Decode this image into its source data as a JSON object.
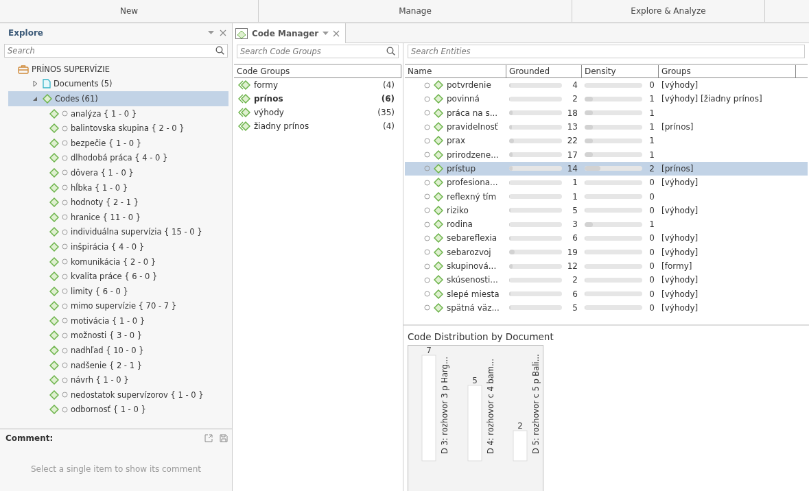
{
  "ribbon_tabs": [
    {
      "label": "New"
    },
    {
      "label": "Manage"
    },
    {
      "label": "Explore & Analyze"
    }
  ],
  "explore": {
    "title": "Explore",
    "search": {
      "placeholder": "Search"
    },
    "tree": [
      {
        "label": "PRÍNOS SUPERVÍZIE",
        "kind": "project",
        "selected": false,
        "children": [
          {
            "label": "Documents (5)",
            "kind": "documents",
            "expanded": false,
            "selected": false
          },
          {
            "label": "Codes (61)",
            "kind": "codes",
            "expanded": true,
            "selected": true,
            "children": [
              {
                "label": "analýza { 1 - 0 }",
                "kind": "code",
                "selected": false
              },
              {
                "label": "balintovska skupina { 2 - 0 }",
                "kind": "code",
                "selected": false
              },
              {
                "label": "bezpečie { 1 - 0 }",
                "kind": "code",
                "selected": false
              },
              {
                "label": "dlhodobá práca { 4 - 0 }",
                "kind": "code",
                "selected": false
              },
              {
                "label": "dôvera { 1 - 0 }",
                "kind": "code",
                "selected": false
              },
              {
                "label": "hĺbka { 1 - 0 }",
                "kind": "code",
                "selected": false
              },
              {
                "label": "hodnoty { 2 - 1 }",
                "kind": "code",
                "selected": false
              },
              {
                "label": "hranice { 11 - 0 }",
                "kind": "code",
                "selected": false
              },
              {
                "label": "individuálna supervízia { 15 - 0 }",
                "kind": "code",
                "selected": false
              },
              {
                "label": "inšpirácia { 4 - 0 }",
                "kind": "code",
                "selected": false
              },
              {
                "label": "komunikácia { 2 - 0 }",
                "kind": "code",
                "selected": false
              },
              {
                "label": "kvalita práce { 6 - 0 }",
                "kind": "code",
                "selected": false
              },
              {
                "label": "limity { 6 - 0 }",
                "kind": "code",
                "selected": false
              },
              {
                "label": "mimo supervízie { 70 - 7 }",
                "kind": "code",
                "selected": false
              },
              {
                "label": "motivácia { 1 - 0 }",
                "kind": "code",
                "selected": false
              },
              {
                "label": "možnosti { 3 - 0 }",
                "kind": "code",
                "selected": false
              },
              {
                "label": "nadhľad { 10 - 0 }",
                "kind": "code",
                "selected": false
              },
              {
                "label": "nadšenie { 2 - 1 }",
                "kind": "code",
                "selected": false
              },
              {
                "label": "návrh { 1 - 0 }",
                "kind": "code",
                "selected": false
              },
              {
                "label": "nedostatok supervízorov { 1 - 0 }",
                "kind": "code",
                "selected": false
              },
              {
                "label": "odbornosť { 1 - 0 }",
                "kind": "code",
                "selected": false
              }
            ]
          }
        ]
      }
    ]
  },
  "comment": {
    "title": "Comment:",
    "hint": "Select a single item to show its comment"
  },
  "code_manager": {
    "tab": "Code Manager",
    "groups_search": {
      "placeholder": "Search Code Groups"
    },
    "groups_header": "Code Groups",
    "groups": [
      {
        "name": "formy",
        "count": "(4)",
        "selected": false
      },
      {
        "name": "prínos",
        "count": "(6)",
        "selected": true
      },
      {
        "name": "výhody",
        "count": "(35)",
        "selected": false
      },
      {
        "name": "žiadny prínos",
        "count": "(4)",
        "selected": false
      }
    ],
    "entities_search": {
      "placeholder": "Search Entities"
    },
    "columns": [
      "Name",
      "Grounded",
      "Density",
      "Groups"
    ],
    "rows": [
      {
        "name": "potvrdenie",
        "grounded": {
          "value": "4",
          "level": 0.02
        },
        "density": {
          "value": "0",
          "level": 0
        },
        "groups": "[výhody]",
        "selected": false
      },
      {
        "name": "povinná",
        "grounded": {
          "value": "2",
          "level": 0.01
        },
        "density": {
          "value": "1",
          "level": 0.14
        },
        "groups": "[výhody] [žiadny prínos]",
        "selected": false
      },
      {
        "name": "práca na s...",
        "grounded": {
          "value": "18",
          "level": 0.07
        },
        "density": {
          "value": "1",
          "level": 0.14
        },
        "selected": false
      },
      {
        "name": "pravidelnosť",
        "grounded": {
          "value": "13",
          "level": 0.05
        },
        "density": {
          "value": "1",
          "level": 0.14
        },
        "groups": "[prínos]",
        "selected": false
      },
      {
        "name": "prax",
        "grounded": {
          "value": "22",
          "level": 0.09
        },
        "density": {
          "value": "1",
          "level": 0.14
        },
        "selected": false
      },
      {
        "name": "prirodzene...",
        "grounded": {
          "value": "17",
          "level": 0.07
        },
        "density": {
          "value": "1",
          "level": 0.14
        },
        "selected": false
      },
      {
        "name": "prístup",
        "grounded": {
          "value": "14",
          "level": 0.06
        },
        "density": {
          "value": "2",
          "level": 0.27
        },
        "groups": "[prínos]",
        "selected": true
      },
      {
        "name": "profesiona...",
        "grounded": {
          "value": "1",
          "level": 0.01
        },
        "density": {
          "value": "0",
          "level": 0
        },
        "groups": "[výhody]",
        "selected": false
      },
      {
        "name": "reflexný tím",
        "grounded": {
          "value": "1",
          "level": 0.01
        },
        "density": {
          "value": "0",
          "level": 0
        },
        "selected": false
      },
      {
        "name": "riziko",
        "grounded": {
          "value": "5",
          "level": 0.02
        },
        "density": {
          "value": "0",
          "level": 0
        },
        "groups": "[výhody]",
        "selected": false
      },
      {
        "name": "rodina",
        "grounded": {
          "value": "3",
          "level": 0.01
        },
        "density": {
          "value": "1",
          "level": 0.14
        },
        "selected": false
      },
      {
        "name": "sebareflexia",
        "grounded": {
          "value": "6",
          "level": 0.02
        },
        "density": {
          "value": "0",
          "level": 0
        },
        "groups": "[výhody]",
        "selected": false
      },
      {
        "name": "sebarozvoj",
        "grounded": {
          "value": "19",
          "level": 0.1
        },
        "density": {
          "value": "0",
          "level": 0
        },
        "groups": "[výhody]",
        "selected": false
      },
      {
        "name": "skupinová...",
        "grounded": {
          "value": "12",
          "level": 0.06
        },
        "density": {
          "value": "0",
          "level": 0
        },
        "groups": "[formy]",
        "selected": false
      },
      {
        "name": "skúsenosti...",
        "grounded": {
          "value": "2",
          "level": 0.01
        },
        "density": {
          "value": "0",
          "level": 0
        },
        "groups": "[výhody]",
        "selected": false
      },
      {
        "name": "slepé miesta",
        "grounded": {
          "value": "6",
          "level": 0.02
        },
        "density": {
          "value": "0",
          "level": 0
        },
        "groups": "[výhody]",
        "selected": false
      },
      {
        "name": "spätná väz...",
        "grounded": {
          "value": "5",
          "level": 0.02
        },
        "density": {
          "value": "0",
          "level": 0
        },
        "groups": "[výhody]",
        "selected": false
      }
    ],
    "distribution": {
      "title": "Code Distribution by Document",
      "chart_data": {
        "type": "bar",
        "categories": [
          "D 3: rozhovor 3 p Harg...",
          "D 4: rozhovor c 4 bam...",
          "D 5: rozhovor c 5 p Bali..."
        ],
        "values": [
          7,
          5,
          2
        ],
        "data_labels": true
      }
    }
  }
}
